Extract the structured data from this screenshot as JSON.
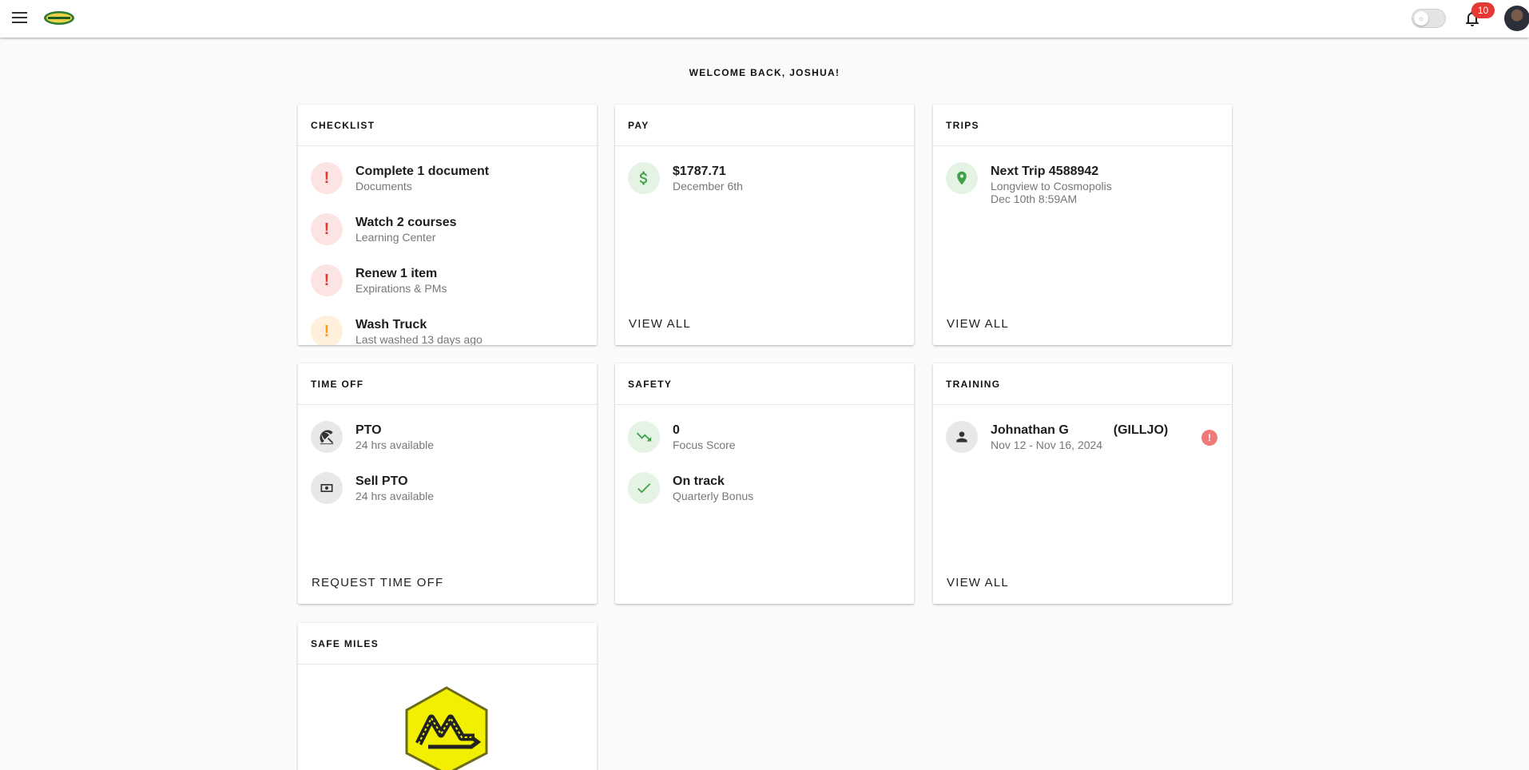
{
  "header": {
    "notification_count": "10",
    "theme_toggle_icon": "sun-icon"
  },
  "welcome": "WELCOME BACK, JOSHUA!",
  "checklist": {
    "title": "CHECKLIST",
    "items": [
      {
        "icon": "!",
        "title": "Complete 1 document",
        "subtitle": "Documents"
      },
      {
        "icon": "!",
        "title": "Watch 2 courses",
        "subtitle": "Learning Center"
      },
      {
        "icon": "!",
        "title": "Renew 1 item",
        "subtitle": "Expirations & PMs"
      },
      {
        "icon": "!",
        "title": "Wash Truck",
        "subtitle": "Last washed 13 days ago"
      }
    ]
  },
  "pay": {
    "title": "PAY",
    "amount": "$1787.71",
    "date": "December 6th",
    "action": "VIEW ALL"
  },
  "trips": {
    "title": "TRIPS",
    "next": "Next Trip 4588942",
    "route": "Longview to Cosmopolis",
    "when": "Dec 10th 8:59AM",
    "action": "VIEW ALL"
  },
  "time_off": {
    "title": "TIME OFF",
    "items": [
      {
        "title": "PTO",
        "subtitle": "24 hrs available"
      },
      {
        "title": "Sell PTO",
        "subtitle": "24 hrs available"
      }
    ],
    "action": "REQUEST TIME OFF"
  },
  "safety": {
    "title": "SAFETY",
    "items": [
      {
        "title": "0",
        "subtitle": "Focus Score"
      },
      {
        "title": "On track",
        "subtitle": "Quarterly Bonus"
      }
    ]
  },
  "training": {
    "title": "TRAINING",
    "name": "Johnathan G",
    "code": "(GILLJO)",
    "dates": "Nov 12 - Nov 16, 2024",
    "alert": "!",
    "action": "VIEW ALL"
  },
  "safe_miles": {
    "title": "SAFE MILES"
  },
  "colors": {
    "alert_red": "#e53935",
    "warning_orange": "#f59c1a",
    "success_green": "#43a047",
    "badge_yellow": "#f2f000"
  }
}
